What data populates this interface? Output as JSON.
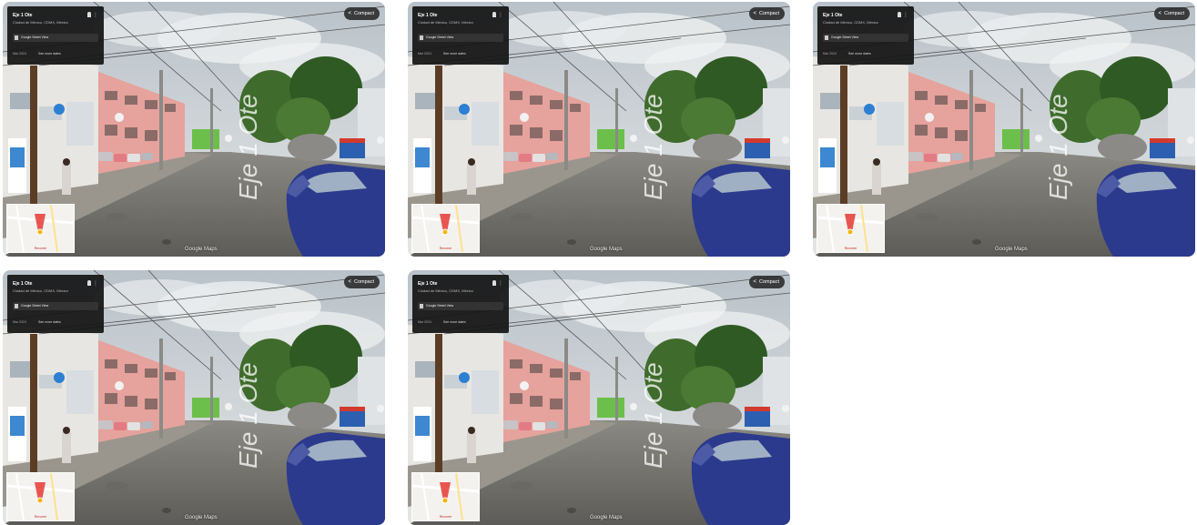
{
  "tiles": [
    {
      "address": "Eje 1 Ote",
      "city": "Ciudad de México, CDMX, México",
      "captured_by": "Google Street View",
      "date": "Mar 2024",
      "see_more": "See more dates",
      "compact_label": "Compact",
      "map_explore": "Recorrer",
      "street_label": "Eje 1 Ote",
      "attribution": "Google Maps"
    },
    {
      "address": "Eje 1 Ote",
      "city": "Ciudad de México, CDMX, México",
      "captured_by": "Google Street View",
      "date": "Mar 2024",
      "see_more": "See more dates",
      "compact_label": "Compact",
      "map_explore": "Recorrer",
      "street_label": "Eje 1 Ote",
      "attribution": "Google Maps"
    },
    {
      "address": "Eje 1 Ote",
      "city": "Ciudad de México, CDMX, México",
      "captured_by": "Google Street View",
      "date": "Mar 2024",
      "see_more": "See more dates",
      "compact_label": "Compact",
      "map_explore": "Recorrer",
      "street_label": "Eje 1 Ote",
      "attribution": "Google Maps"
    },
    {
      "address": "Eje 1 Ote",
      "city": "Ciudad de México, CDMX, México",
      "captured_by": "Google Street View",
      "date": "Mar 2024",
      "see_more": "See more dates",
      "compact_label": "Compact",
      "map_explore": "Recorrer",
      "street_label": "Eje 1 Ote",
      "attribution": "Google Maps"
    },
    {
      "address": "Eje 1 Ote",
      "city": "Ciudad de México, CDMX, México",
      "captured_by": "Google Street View",
      "date": "Mar 2024",
      "see_more": "See more dates",
      "compact_label": "Compact",
      "map_explore": "Recorrer",
      "street_label": "Eje 1 Ote",
      "attribution": "Google Maps"
    }
  ],
  "colors": {
    "sky": "#cfd6dc",
    "road": "#6f6e6a",
    "building_pink": "#e7a09a",
    "trees": "#3f6b2c",
    "car_blue": "#2b3a8c"
  },
  "icons": {
    "compact": "share-arrow-icon",
    "menu": "more-vert-icon",
    "camera": "camera-icon",
    "pin": "map-pin-icon"
  }
}
